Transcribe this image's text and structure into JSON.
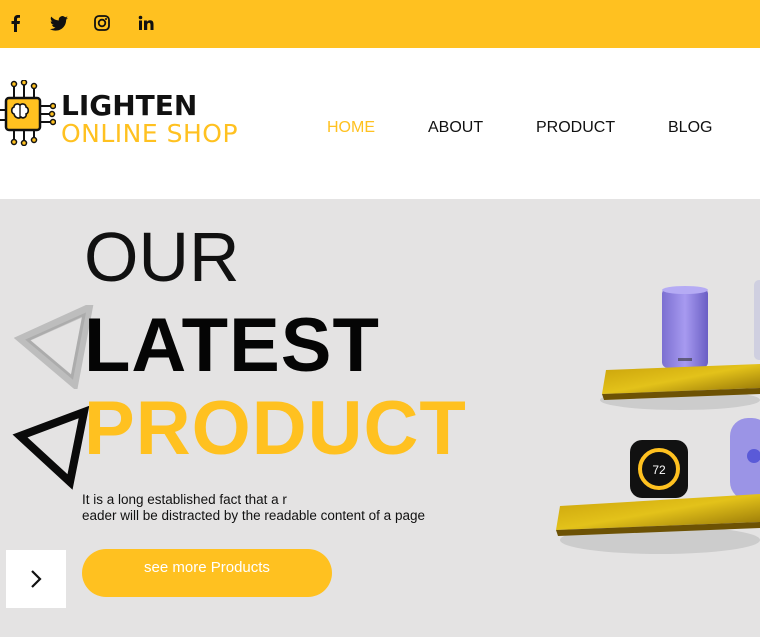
{
  "topbar": {
    "color": "#ffc120",
    "social_icons": [
      "facebook-icon",
      "twitter-icon",
      "instagram-icon",
      "linkedin-icon"
    ]
  },
  "brand": {
    "name_line1": "LIGHTEN",
    "name_line2": "ONLINE SHOP",
    "accent": "#ffc120"
  },
  "nav": {
    "items": [
      {
        "label": "HOME",
        "active": true
      },
      {
        "label": "ABOUT",
        "active": false
      },
      {
        "label": "PRODUCT",
        "active": false
      },
      {
        "label": "BLOG",
        "active": false
      }
    ]
  },
  "hero": {
    "line1": "OUR",
    "line2": "LATEST",
    "line3": "PRODUCT",
    "description_line1": "It is a long established fact that a r",
    "description_line2": "eader will be distracted by the readable content of a page",
    "cta_label": "see more Products",
    "thermostat_reading": "72"
  }
}
